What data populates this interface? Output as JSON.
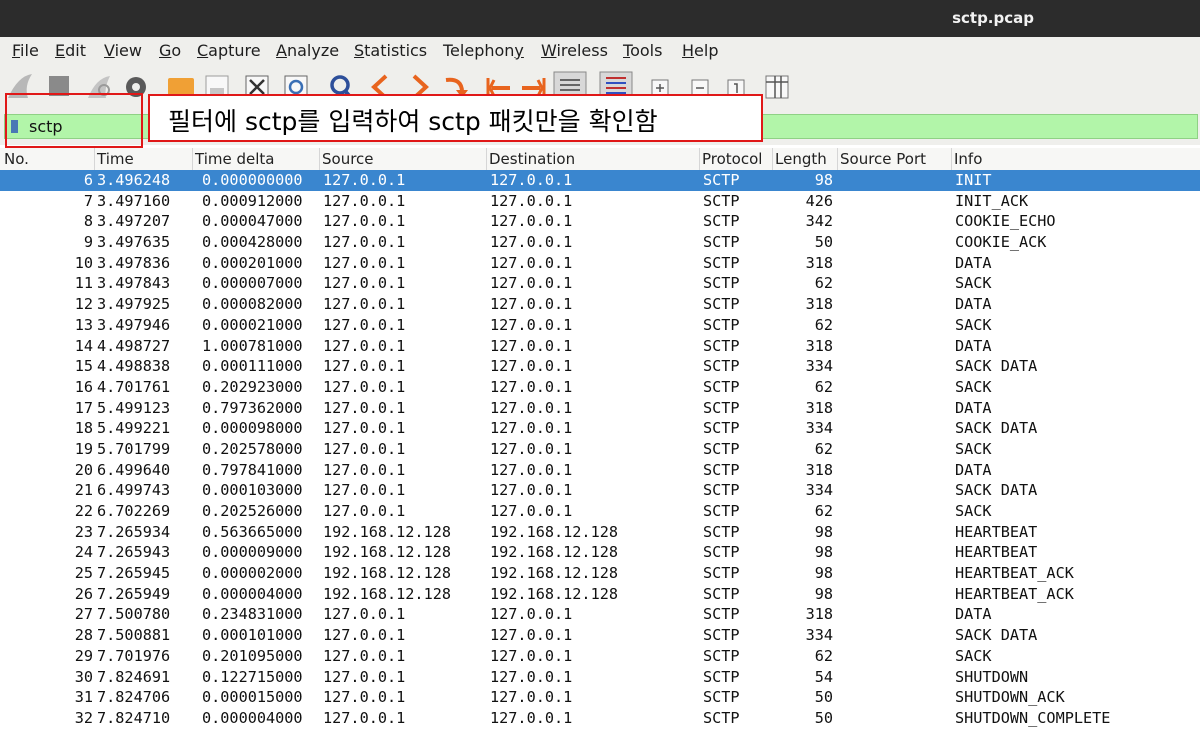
{
  "window": {
    "title": "sctp.pcap"
  },
  "menu": [
    {
      "u": "F",
      "rest": "ile"
    },
    {
      "u": "E",
      "rest": "dit"
    },
    {
      "u": "V",
      "rest": "iew"
    },
    {
      "u": "G",
      "rest": "o"
    },
    {
      "u": "C",
      "rest": "apture"
    },
    {
      "u": "A",
      "rest": "nalyze"
    },
    {
      "u": "S",
      "rest": "tatistics"
    },
    {
      "pre": "Telephon",
      "u": "y",
      "rest": ""
    },
    {
      "u": "W",
      "rest": "ireless"
    },
    {
      "u": "T",
      "rest": "ools"
    },
    {
      "u": "H",
      "rest": "elp"
    }
  ],
  "toolbar_icons": [
    "shark-fin-icon",
    "stop-icon",
    "restart-icon",
    "options-gear-icon",
    "open-folder-icon",
    "save-icon",
    "close-file-icon",
    "reload-icon",
    "find-icon",
    "back-icon",
    "forward-icon",
    "go-to-packet-icon",
    "first-packet-icon",
    "last-packet-icon",
    "autoscroll-icon",
    "colorize-icon",
    "zoom-in-icon",
    "zoom-out-icon",
    "normal-size-icon",
    "resize-columns-icon"
  ],
  "filter": {
    "value": "sctp"
  },
  "annotation": {
    "text": "필터에 sctp를 입력하여 sctp 패킷만을 확인함"
  },
  "columns": [
    "No.",
    "Time",
    "Time delta",
    "Source",
    "Destination",
    "Protocol",
    "Length",
    "Source Port",
    "Info"
  ],
  "packets": [
    {
      "no": "6",
      "time": "3.496248",
      "delta": "0.000000000",
      "src": "127.0.0.1",
      "dst": "127.0.0.1",
      "proto": "SCTP",
      "len": "98",
      "info": "INIT",
      "selected": true
    },
    {
      "no": "7",
      "time": "3.497160",
      "delta": "0.000912000",
      "src": "127.0.0.1",
      "dst": "127.0.0.1",
      "proto": "SCTP",
      "len": "426",
      "info": "INIT_ACK"
    },
    {
      "no": "8",
      "time": "3.497207",
      "delta": "0.000047000",
      "src": "127.0.0.1",
      "dst": "127.0.0.1",
      "proto": "SCTP",
      "len": "342",
      "info": "COOKIE_ECHO"
    },
    {
      "no": "9",
      "time": "3.497635",
      "delta": "0.000428000",
      "src": "127.0.0.1",
      "dst": "127.0.0.1",
      "proto": "SCTP",
      "len": "50",
      "info": "COOKIE_ACK"
    },
    {
      "no": "10",
      "time": "3.497836",
      "delta": "0.000201000",
      "src": "127.0.0.1",
      "dst": "127.0.0.1",
      "proto": "SCTP",
      "len": "318",
      "info": "DATA"
    },
    {
      "no": "11",
      "time": "3.497843",
      "delta": "0.000007000",
      "src": "127.0.0.1",
      "dst": "127.0.0.1",
      "proto": "SCTP",
      "len": "62",
      "info": "SACK"
    },
    {
      "no": "12",
      "time": "3.497925",
      "delta": "0.000082000",
      "src": "127.0.0.1",
      "dst": "127.0.0.1",
      "proto": "SCTP",
      "len": "318",
      "info": "DATA"
    },
    {
      "no": "13",
      "time": "3.497946",
      "delta": "0.000021000",
      "src": "127.0.0.1",
      "dst": "127.0.0.1",
      "proto": "SCTP",
      "len": "62",
      "info": "SACK"
    },
    {
      "no": "14",
      "time": "4.498727",
      "delta": "1.000781000",
      "src": "127.0.0.1",
      "dst": "127.0.0.1",
      "proto": "SCTP",
      "len": "318",
      "info": "DATA"
    },
    {
      "no": "15",
      "time": "4.498838",
      "delta": "0.000111000",
      "src": "127.0.0.1",
      "dst": "127.0.0.1",
      "proto": "SCTP",
      "len": "334",
      "info": "SACK DATA"
    },
    {
      "no": "16",
      "time": "4.701761",
      "delta": "0.202923000",
      "src": "127.0.0.1",
      "dst": "127.0.0.1",
      "proto": "SCTP",
      "len": "62",
      "info": "SACK"
    },
    {
      "no": "17",
      "time": "5.499123",
      "delta": "0.797362000",
      "src": "127.0.0.1",
      "dst": "127.0.0.1",
      "proto": "SCTP",
      "len": "318",
      "info": "DATA"
    },
    {
      "no": "18",
      "time": "5.499221",
      "delta": "0.000098000",
      "src": "127.0.0.1",
      "dst": "127.0.0.1",
      "proto": "SCTP",
      "len": "334",
      "info": "SACK DATA"
    },
    {
      "no": "19",
      "time": "5.701799",
      "delta": "0.202578000",
      "src": "127.0.0.1",
      "dst": "127.0.0.1",
      "proto": "SCTP",
      "len": "62",
      "info": "SACK"
    },
    {
      "no": "20",
      "time": "6.499640",
      "delta": "0.797841000",
      "src": "127.0.0.1",
      "dst": "127.0.0.1",
      "proto": "SCTP",
      "len": "318",
      "info": "DATA"
    },
    {
      "no": "21",
      "time": "6.499743",
      "delta": "0.000103000",
      "src": "127.0.0.1",
      "dst": "127.0.0.1",
      "proto": "SCTP",
      "len": "334",
      "info": "SACK DATA"
    },
    {
      "no": "22",
      "time": "6.702269",
      "delta": "0.202526000",
      "src": "127.0.0.1",
      "dst": "127.0.0.1",
      "proto": "SCTP",
      "len": "62",
      "info": "SACK"
    },
    {
      "no": "23",
      "time": "7.265934",
      "delta": "0.563665000",
      "src": "192.168.12.128",
      "dst": "192.168.12.128",
      "proto": "SCTP",
      "len": "98",
      "info": "HEARTBEAT"
    },
    {
      "no": "24",
      "time": "7.265943",
      "delta": "0.000009000",
      "src": "192.168.12.128",
      "dst": "192.168.12.128",
      "proto": "SCTP",
      "len": "98",
      "info": "HEARTBEAT"
    },
    {
      "no": "25",
      "time": "7.265945",
      "delta": "0.000002000",
      "src": "192.168.12.128",
      "dst": "192.168.12.128",
      "proto": "SCTP",
      "len": "98",
      "info": "HEARTBEAT_ACK"
    },
    {
      "no": "26",
      "time": "7.265949",
      "delta": "0.000004000",
      "src": "192.168.12.128",
      "dst": "192.168.12.128",
      "proto": "SCTP",
      "len": "98",
      "info": "HEARTBEAT_ACK"
    },
    {
      "no": "27",
      "time": "7.500780",
      "delta": "0.234831000",
      "src": "127.0.0.1",
      "dst": "127.0.0.1",
      "proto": "SCTP",
      "len": "318",
      "info": "DATA"
    },
    {
      "no": "28",
      "time": "7.500881",
      "delta": "0.000101000",
      "src": "127.0.0.1",
      "dst": "127.0.0.1",
      "proto": "SCTP",
      "len": "334",
      "info": "SACK DATA"
    },
    {
      "no": "29",
      "time": "7.701976",
      "delta": "0.201095000",
      "src": "127.0.0.1",
      "dst": "127.0.0.1",
      "proto": "SCTP",
      "len": "62",
      "info": "SACK"
    },
    {
      "no": "30",
      "time": "7.824691",
      "delta": "0.122715000",
      "src": "127.0.0.1",
      "dst": "127.0.0.1",
      "proto": "SCTP",
      "len": "54",
      "info": "SHUTDOWN"
    },
    {
      "no": "31",
      "time": "7.824706",
      "delta": "0.000015000",
      "src": "127.0.0.1",
      "dst": "127.0.0.1",
      "proto": "SCTP",
      "len": "50",
      "info": "SHUTDOWN_ACK"
    },
    {
      "no": "32",
      "time": "7.824710",
      "delta": "0.000004000",
      "src": "127.0.0.1",
      "dst": "127.0.0.1",
      "proto": "SCTP",
      "len": "50",
      "info": "SHUTDOWN_COMPLETE"
    }
  ],
  "colors": {
    "filter_valid": "#b2f5a9",
    "selection": "#3a86cf",
    "highlight": "#e01818"
  }
}
